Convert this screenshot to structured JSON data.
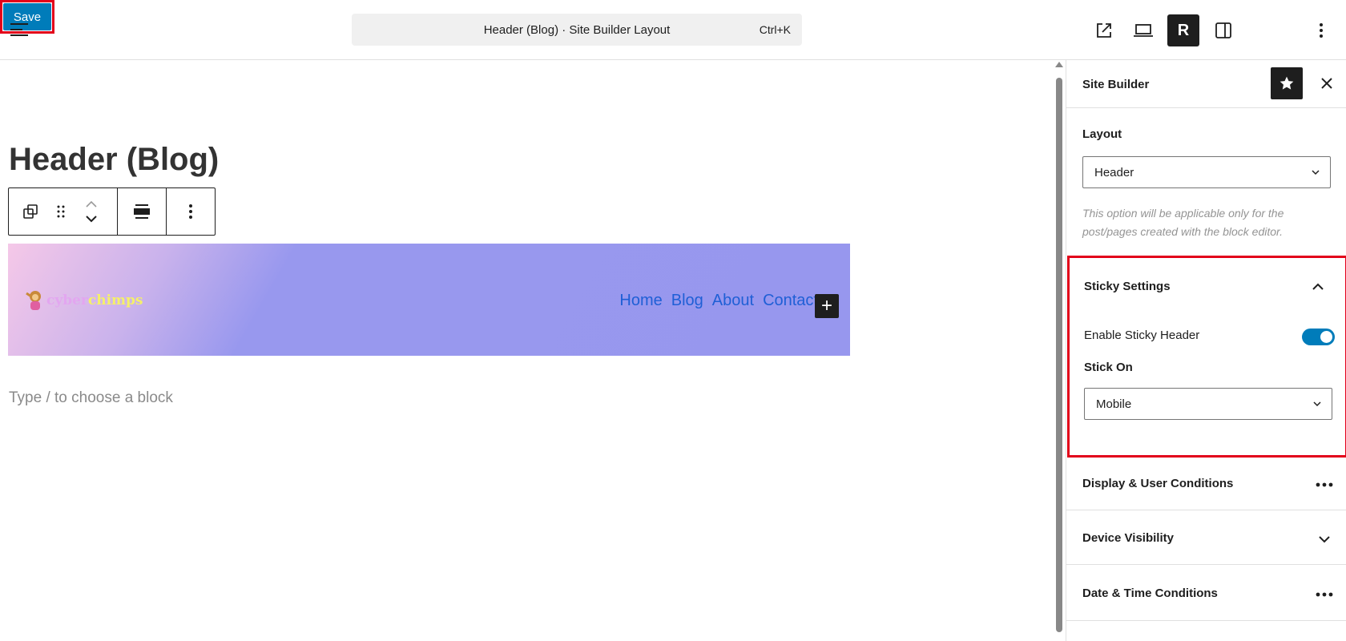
{
  "topbar": {
    "command_title": "Header (Blog) · Site Builder Layout",
    "command_shortcut": "Ctrl+K",
    "r_label": "R",
    "save_label": "Save"
  },
  "canvas": {
    "page_title": "Header (Blog)",
    "logo": {
      "part1": "cyber",
      "part2": "chimps"
    },
    "nav_items": [
      "Home",
      "Blog",
      "About",
      "Contact"
    ],
    "add_symbol": "+",
    "placeholder": "Type / to choose a block"
  },
  "sidebar": {
    "title": "Site Builder",
    "layout_label": "Layout",
    "layout_value": "Header",
    "layout_help": "This option will be applicable only for the post/pages created with the block editor.",
    "sticky": {
      "title": "Sticky Settings",
      "enable_label": "Enable Sticky Header",
      "enabled": true,
      "stick_on_label": "Stick On",
      "stick_on_value": "Mobile"
    },
    "sections": [
      {
        "title": "Display & User Conditions",
        "icon": "more-horizontal-icon"
      },
      {
        "title": "Device Visibility",
        "icon": "chevron-down-icon"
      },
      {
        "title": "Date & Time Conditions",
        "icon": "more-horizontal-icon"
      }
    ]
  },
  "colors": {
    "accent": "#007cba",
    "highlight": "#e2001a",
    "nav_link": "#1f5fd6"
  }
}
